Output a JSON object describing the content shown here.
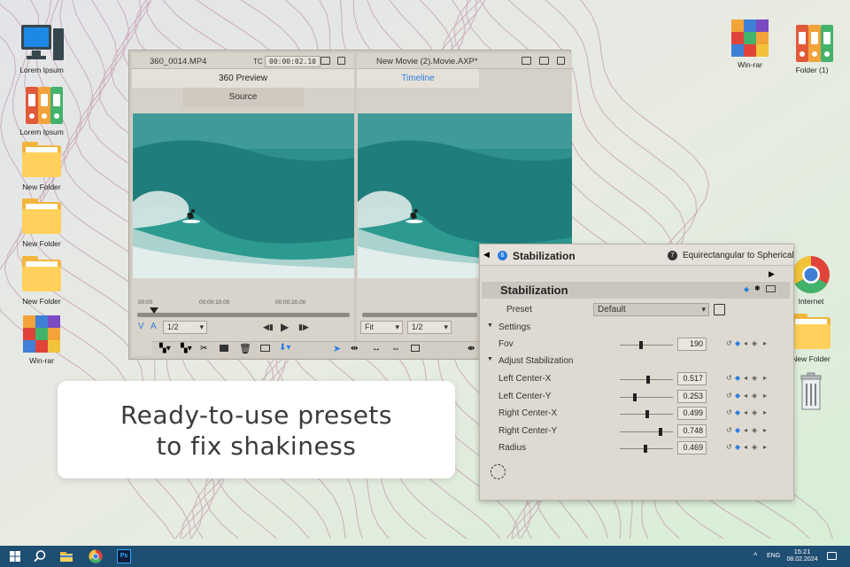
{
  "desktop": {
    "left_icons": [
      {
        "label": "Lorem Ipsum",
        "icon": "computer-icon"
      },
      {
        "label": "Lorem Ipsum",
        "icon": "binders-icon"
      },
      {
        "label": "New Folder",
        "icon": "folder-icon"
      },
      {
        "label": "New Folder",
        "icon": "folder-icon"
      },
      {
        "label": "New Folder",
        "icon": "folder-icon"
      },
      {
        "label": "Win-rar",
        "icon": "winrar-icon"
      }
    ],
    "right_icons": [
      {
        "label": "Win-rar",
        "icon": "winrar-icon"
      },
      {
        "label": "Folder (1)",
        "icon": "binders-icon"
      },
      {
        "label": "Internet",
        "icon": "chrome-icon"
      },
      {
        "label": "New Folder",
        "icon": "folder-icon"
      },
      {
        "label": "",
        "icon": "recycle-bin-icon"
      }
    ]
  },
  "editor": {
    "source_pane": {
      "filename": "360_0014.MP4",
      "tc_label": "TC",
      "timecode": "00:00:02.10",
      "tab_active": "360 Preview",
      "tab_inactive": "Source",
      "ruler": [
        "00:00",
        "00:00:10.00",
        "00:00:20.00"
      ],
      "v_label": "V",
      "a_label": "A",
      "zoom": "1/2"
    },
    "timeline_pane": {
      "filename": "New Movie (2).Movie.AXP*",
      "tab_active": "Timeline",
      "fit": "Fit",
      "zoom": "1/2"
    }
  },
  "stabilization": {
    "badge": "6",
    "title": "Stabilization",
    "effect_badge": "7",
    "next_effect": "Equirectangular to Spherical",
    "header": "Stabilization",
    "preset_label": "Preset",
    "preset_value": "Default",
    "settings_label": "Settings",
    "fov_label": "Fov",
    "fov_value": "190",
    "adjust_label": "Adjust Stabilization",
    "params": [
      {
        "label": "Left Center-X",
        "value": "0.517",
        "level": 0.52
      },
      {
        "label": "Left Center-Y",
        "value": "0.253",
        "level": 0.25
      },
      {
        "label": "Right Center-X",
        "value": "0.499",
        "level": 0.5
      },
      {
        "label": "Right Center-Y",
        "value": "0.748",
        "level": 0.75
      },
      {
        "label": "Radius",
        "value": "0.469",
        "level": 0.47
      }
    ],
    "fov_level": 0.38
  },
  "banner": {
    "line1": "Ready-to-use presets",
    "line2": "to fix shakiness"
  },
  "taskbar": {
    "lang": "ENG",
    "time": "15:21",
    "date": "08.02.2024"
  },
  "colors": {
    "accent": "#2b7de0",
    "taskbar": "#1f4e73",
    "ocean": "#1f8d8a"
  }
}
